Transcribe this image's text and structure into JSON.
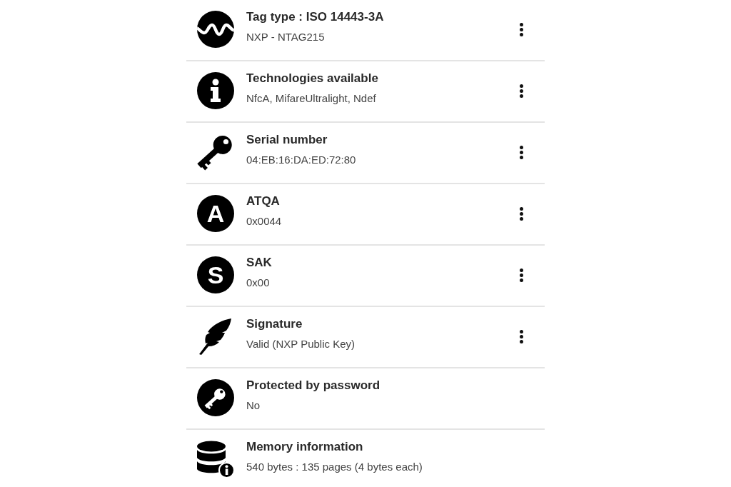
{
  "items": [
    {
      "kind": "waveform",
      "title": "Tag type : ISO 14443-3A",
      "subtitle": "NXP - NTAG215",
      "has_menu": true
    },
    {
      "kind": "info",
      "title": "Technologies available",
      "subtitle": "NfcA, MifareUltralight, Ndef",
      "has_menu": true
    },
    {
      "kind": "key",
      "title": "Serial number",
      "subtitle": "04:EB:16:DA:ED:72:80",
      "has_menu": true
    },
    {
      "kind": "letter",
      "icon_text": "A",
      "title": "ATQA",
      "subtitle": "0x0044",
      "has_menu": true
    },
    {
      "kind": "letter",
      "icon_text": "S",
      "title": "SAK",
      "subtitle": "0x00",
      "has_menu": true
    },
    {
      "kind": "feather",
      "title": "Signature",
      "subtitle": "Valid (NXP Public Key)",
      "has_menu": true
    },
    {
      "kind": "password",
      "title": "Protected by password",
      "subtitle": "No",
      "has_menu": false
    },
    {
      "kind": "memory",
      "title": "Memory information",
      "subtitle": "540 bytes : 135 pages (4 bytes each)",
      "has_menu": false
    }
  ]
}
